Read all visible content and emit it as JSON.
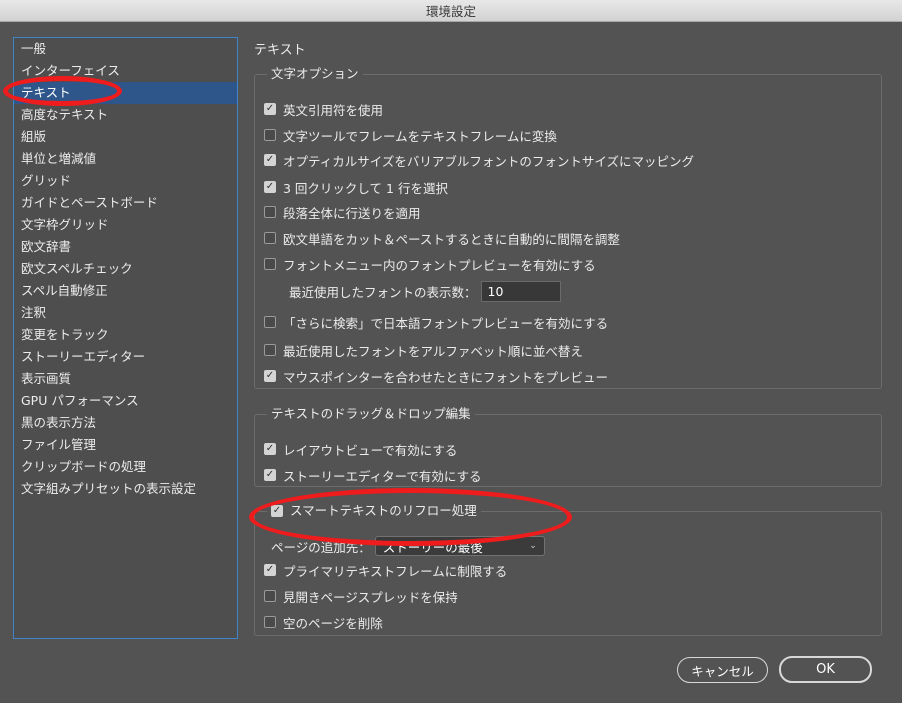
{
  "window": {
    "title": "環境設定"
  },
  "sidebar": {
    "items": [
      {
        "label": "一般"
      },
      {
        "label": "インターフェイス"
      },
      {
        "label": "テキスト",
        "selected": true
      },
      {
        "label": "高度なテキスト"
      },
      {
        "label": "組版"
      },
      {
        "label": "単位と増減値"
      },
      {
        "label": "グリッド"
      },
      {
        "label": "ガイドとペーストボード"
      },
      {
        "label": "文字枠グリッド"
      },
      {
        "label": "欧文辞書"
      },
      {
        "label": "欧文スペルチェック"
      },
      {
        "label": "スペル自動修正"
      },
      {
        "label": "注釈"
      },
      {
        "label": "変更をトラック"
      },
      {
        "label": "ストーリーエディター"
      },
      {
        "label": "表示画質"
      },
      {
        "label": "GPU パフォーマンス"
      },
      {
        "label": "黒の表示方法"
      },
      {
        "label": "ファイル管理"
      },
      {
        "label": "クリップボードの処理"
      },
      {
        "label": "文字組みプリセットの表示設定"
      }
    ]
  },
  "panel": {
    "title": "テキスト",
    "char_options": {
      "legend": "文字オプション",
      "options": {
        "typographer_quotes": {
          "label": "英文引用符を使用",
          "checked": true
        },
        "text_tool_convert": {
          "label": "文字ツールでフレームをテキストフレームに変換",
          "checked": false
        },
        "optical_size": {
          "label": "オプティカルサイズをバリアブルフォントのフォントサイズにマッピング",
          "checked": true
        },
        "triple_click": {
          "label": "3 回クリックして 1 行を選択",
          "checked": true
        },
        "apply_leading": {
          "label": "段落全体に行送りを適用",
          "checked": false
        },
        "adjust_spacing": {
          "label": "欧文単語をカット＆ペーストするときに自動的に間隔を調整",
          "checked": false
        },
        "font_preview": {
          "label": "フォントメニュー内のフォントプレビューを有効にする",
          "checked": false
        },
        "search_preview": {
          "label": "「さらに検索」で日本語フォントプレビューを有効にする",
          "checked": false
        },
        "alpha_sort": {
          "label": "最近使用したフォントをアルファベット順に並べ替え",
          "checked": false
        },
        "hover_preview": {
          "label": "マウスポインターを合わせたときにフォントをプレビュー",
          "checked": true
        }
      },
      "recent_fonts": {
        "label": "最近使用したフォントの表示数：",
        "value": "10"
      }
    },
    "drag_drop": {
      "legend": "テキストのドラッグ＆ドロップ編集",
      "options": {
        "layout_view": {
          "label": "レイアウトビューで有効にする",
          "checked": true
        },
        "story_editor": {
          "label": "ストーリーエディターで有効にする",
          "checked": true
        }
      }
    },
    "smart_reflow": {
      "legend": "スマートテキストのリフロー処理",
      "checked": true,
      "add_pages": {
        "label": "ページの追加先：",
        "value": "ストーリーの最後"
      },
      "options": {
        "primary_frame": {
          "label": "プライマリテキストフレームに制限する",
          "checked": true
        },
        "preserve_spreads": {
          "label": "見開きページスプレッドを保持",
          "checked": false
        },
        "delete_empty": {
          "label": "空のページを削除",
          "checked": false
        }
      }
    }
  },
  "buttons": {
    "cancel": "キャンセル",
    "ok": "OK"
  },
  "colors": {
    "background": "#535353",
    "selection": "#2f568a",
    "annotation": "#ee1c1c",
    "focus_border": "#3f84c8"
  }
}
